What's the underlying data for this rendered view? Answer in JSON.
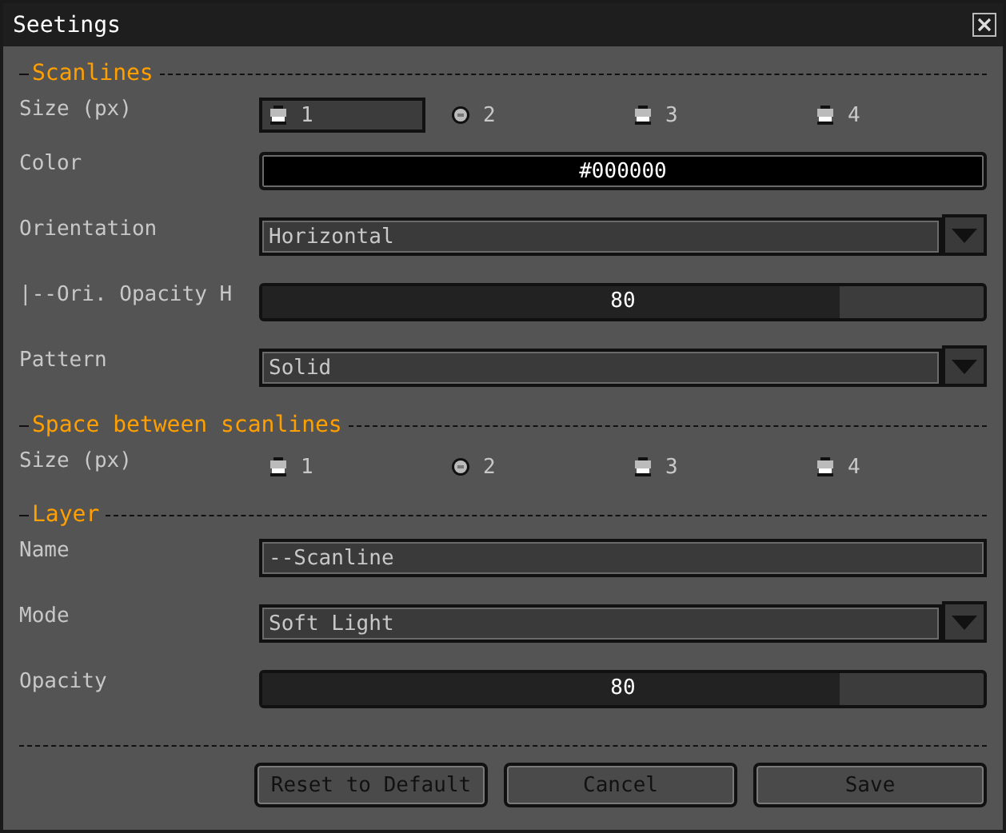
{
  "window": {
    "title": "Seetings"
  },
  "sections": [
    {
      "title": "Scanlines",
      "rows": [
        {
          "kind": "radio",
          "label": "Size (px)",
          "options": [
            {
              "label": "1",
              "selected": false,
              "focused": true
            },
            {
              "label": "2",
              "selected": true,
              "focused": false
            },
            {
              "label": "3",
              "selected": false,
              "focused": false
            },
            {
              "label": "4",
              "selected": false,
              "focused": false
            }
          ]
        },
        {
          "kind": "color",
          "label": "Color",
          "value": "#000000"
        },
        {
          "kind": "dropdown",
          "label": "Orientation",
          "value": "Horizontal"
        },
        {
          "kind": "slider",
          "label": "|--Ori. Opacity H",
          "value": "80",
          "level": 0.8
        },
        {
          "kind": "dropdown",
          "label": "Pattern",
          "value": "Solid"
        }
      ]
    },
    {
      "title": "Space between scanlines",
      "rows": [
        {
          "kind": "radio",
          "label": "Size (px)",
          "options": [
            {
              "label": "1",
              "selected": false,
              "focused": false
            },
            {
              "label": "2",
              "selected": true,
              "focused": false
            },
            {
              "label": "3",
              "selected": false,
              "focused": false
            },
            {
              "label": "4",
              "selected": false,
              "focused": false
            }
          ]
        }
      ]
    },
    {
      "title": "Layer",
      "rows": [
        {
          "kind": "text",
          "label": "Name",
          "value": "--Scanline"
        },
        {
          "kind": "dropdown",
          "label": "Mode",
          "value": "Soft Light"
        },
        {
          "kind": "slider",
          "label": "Opacity",
          "value": "80",
          "level": 0.8
        }
      ]
    }
  ],
  "buttons": [
    "Reset to Default",
    "Cancel",
    "Save"
  ]
}
